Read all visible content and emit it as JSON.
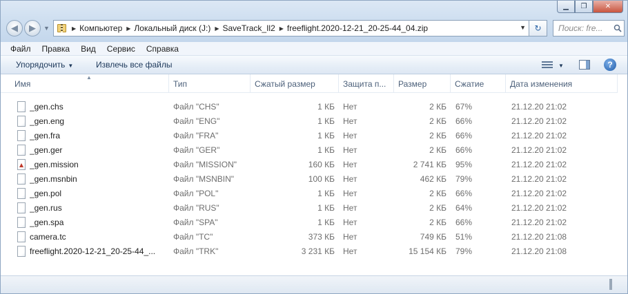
{
  "window": {
    "controls": {
      "minimize": "▁",
      "maximize": "❐",
      "close": "✕"
    }
  },
  "nav": {
    "back": "◀",
    "forward": "▶",
    "dropdown": "▼"
  },
  "address": {
    "breadcrumbs": [
      "Компьютер",
      "Локальный диск (J:)",
      "SaveTrack_Il2",
      "freeflight.2020-12-21_20-25-44_04.zip"
    ],
    "dropdown": "▼",
    "refresh": "↻"
  },
  "search": {
    "placeholder": "Поиск: fre..."
  },
  "menu": [
    "Файл",
    "Правка",
    "Вид",
    "Сервис",
    "Справка"
  ],
  "commands": {
    "organize": "Упорядочить",
    "extract_all": "Извлечь все файлы",
    "caret": "▼",
    "help": "?"
  },
  "columns": [
    "Имя",
    "Тип",
    "Сжатый размер",
    "Защита п...",
    "Размер",
    "Сжатие",
    "Дата изменения"
  ],
  "sort_indicator": "▲",
  "files": [
    {
      "name": "_gen.chs",
      "type": "Файл \"CHS\"",
      "packed": "1 КБ",
      "protected": "Нет",
      "size": "2 КБ",
      "ratio": "67%",
      "modified": "21.12.20 21:02",
      "icon": "file-icon"
    },
    {
      "name": "_gen.eng",
      "type": "Файл \"ENG\"",
      "packed": "1 КБ",
      "protected": "Нет",
      "size": "2 КБ",
      "ratio": "66%",
      "modified": "21.12.20 21:02",
      "icon": "file-icon"
    },
    {
      "name": "_gen.fra",
      "type": "Файл \"FRA\"",
      "packed": "1 КБ",
      "protected": "Нет",
      "size": "2 КБ",
      "ratio": "66%",
      "modified": "21.12.20 21:02",
      "icon": "file-icon"
    },
    {
      "name": "_gen.ger",
      "type": "Файл \"GER\"",
      "packed": "1 КБ",
      "protected": "Нет",
      "size": "2 КБ",
      "ratio": "66%",
      "modified": "21.12.20 21:02",
      "icon": "file-icon"
    },
    {
      "name": "_gen.mission",
      "type": "Файл \"MISSION\"",
      "packed": "160 КБ",
      "protected": "Нет",
      "size": "2 741 КБ",
      "ratio": "95%",
      "modified": "21.12.20 21:02",
      "icon": "mission-file-icon"
    },
    {
      "name": "_gen.msnbin",
      "type": "Файл \"MSNBIN\"",
      "packed": "100 КБ",
      "protected": "Нет",
      "size": "462 КБ",
      "ratio": "79%",
      "modified": "21.12.20 21:02",
      "icon": "file-icon"
    },
    {
      "name": "_gen.pol",
      "type": "Файл \"POL\"",
      "packed": "1 КБ",
      "protected": "Нет",
      "size": "2 КБ",
      "ratio": "66%",
      "modified": "21.12.20 21:02",
      "icon": "file-icon"
    },
    {
      "name": "_gen.rus",
      "type": "Файл \"RUS\"",
      "packed": "1 КБ",
      "protected": "Нет",
      "size": "2 КБ",
      "ratio": "64%",
      "modified": "21.12.20 21:02",
      "icon": "file-icon"
    },
    {
      "name": "_gen.spa",
      "type": "Файл \"SPA\"",
      "packed": "1 КБ",
      "protected": "Нет",
      "size": "2 КБ",
      "ratio": "66%",
      "modified": "21.12.20 21:02",
      "icon": "file-icon"
    },
    {
      "name": "camera.tc",
      "type": "Файл \"TC\"",
      "packed": "373 КБ",
      "protected": "Нет",
      "size": "749 КБ",
      "ratio": "51%",
      "modified": "21.12.20 21:08",
      "icon": "file-icon"
    },
    {
      "name": "freeflight.2020-12-21_20-25-44_...",
      "type": "Файл \"TRK\"",
      "packed": "3 231 КБ",
      "protected": "Нет",
      "size": "15 154 КБ",
      "ratio": "79%",
      "modified": "21.12.20 21:08",
      "icon": "file-icon"
    }
  ]
}
